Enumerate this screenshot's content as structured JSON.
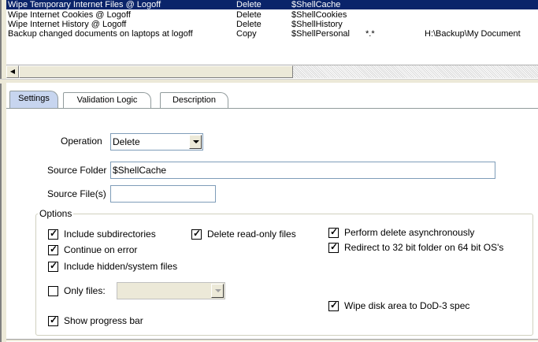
{
  "list": {
    "rows": [
      {
        "name": "Wipe Temporary Internet Files @ Logoff",
        "op": "Delete",
        "folder": "$ShellCache",
        "files": "",
        "dest": "",
        "selected": true
      },
      {
        "name": "Wipe Internet Cookies @ Logoff",
        "op": "Delete",
        "folder": "$ShellCookies",
        "files": "",
        "dest": "",
        "selected": false
      },
      {
        "name": "Wipe Internet History @ Logoff",
        "op": "Delete",
        "folder": "$ShellHistory",
        "files": "",
        "dest": "",
        "selected": false
      },
      {
        "name": "Backup changed documents on laptops at logoff",
        "op": "Copy",
        "folder": "$ShellPersonal",
        "files": "*.*",
        "dest": "H:\\Backup\\My Document",
        "selected": false
      }
    ]
  },
  "scrollbar": {
    "left_arrow": "◀"
  },
  "tabs": [
    {
      "label": "Settings",
      "active": true
    },
    {
      "label": "Validation Logic",
      "active": false
    },
    {
      "label": "Description",
      "active": false
    }
  ],
  "form": {
    "operation_label": "Operation",
    "operation_value": "Delete",
    "source_folder_label": "Source Folder",
    "source_folder_value": "$ShellCache",
    "source_files_label": "Source File(s)",
    "source_files_value": "",
    "options_legend": "Options",
    "only_files_label": "Only files:",
    "only_files_value": ""
  },
  "options": {
    "include_subdirectories": {
      "label": "Include subdirectories",
      "checked": true
    },
    "delete_readonly": {
      "label": "Delete read-only files",
      "checked": true
    },
    "perform_async": {
      "label": "Perform delete asynchronously",
      "checked": true
    },
    "redirect_32bit": {
      "label": "Redirect to 32 bit folder on 64 bit OS's",
      "checked": true
    },
    "continue_on_error": {
      "label": "Continue on error",
      "checked": true
    },
    "include_hidden": {
      "label": "Include hidden/system files",
      "checked": true
    },
    "only_files": {
      "label": "",
      "checked": false
    },
    "wipe_dod": {
      "label": "Wipe disk area to DoD-3 spec",
      "checked": true
    },
    "show_progress": {
      "label": "Show progress bar",
      "checked": true
    }
  },
  "colors": {
    "selection": "#0a246a",
    "tab_active": "#c7d5ef",
    "field_border": "#7f9db9"
  }
}
